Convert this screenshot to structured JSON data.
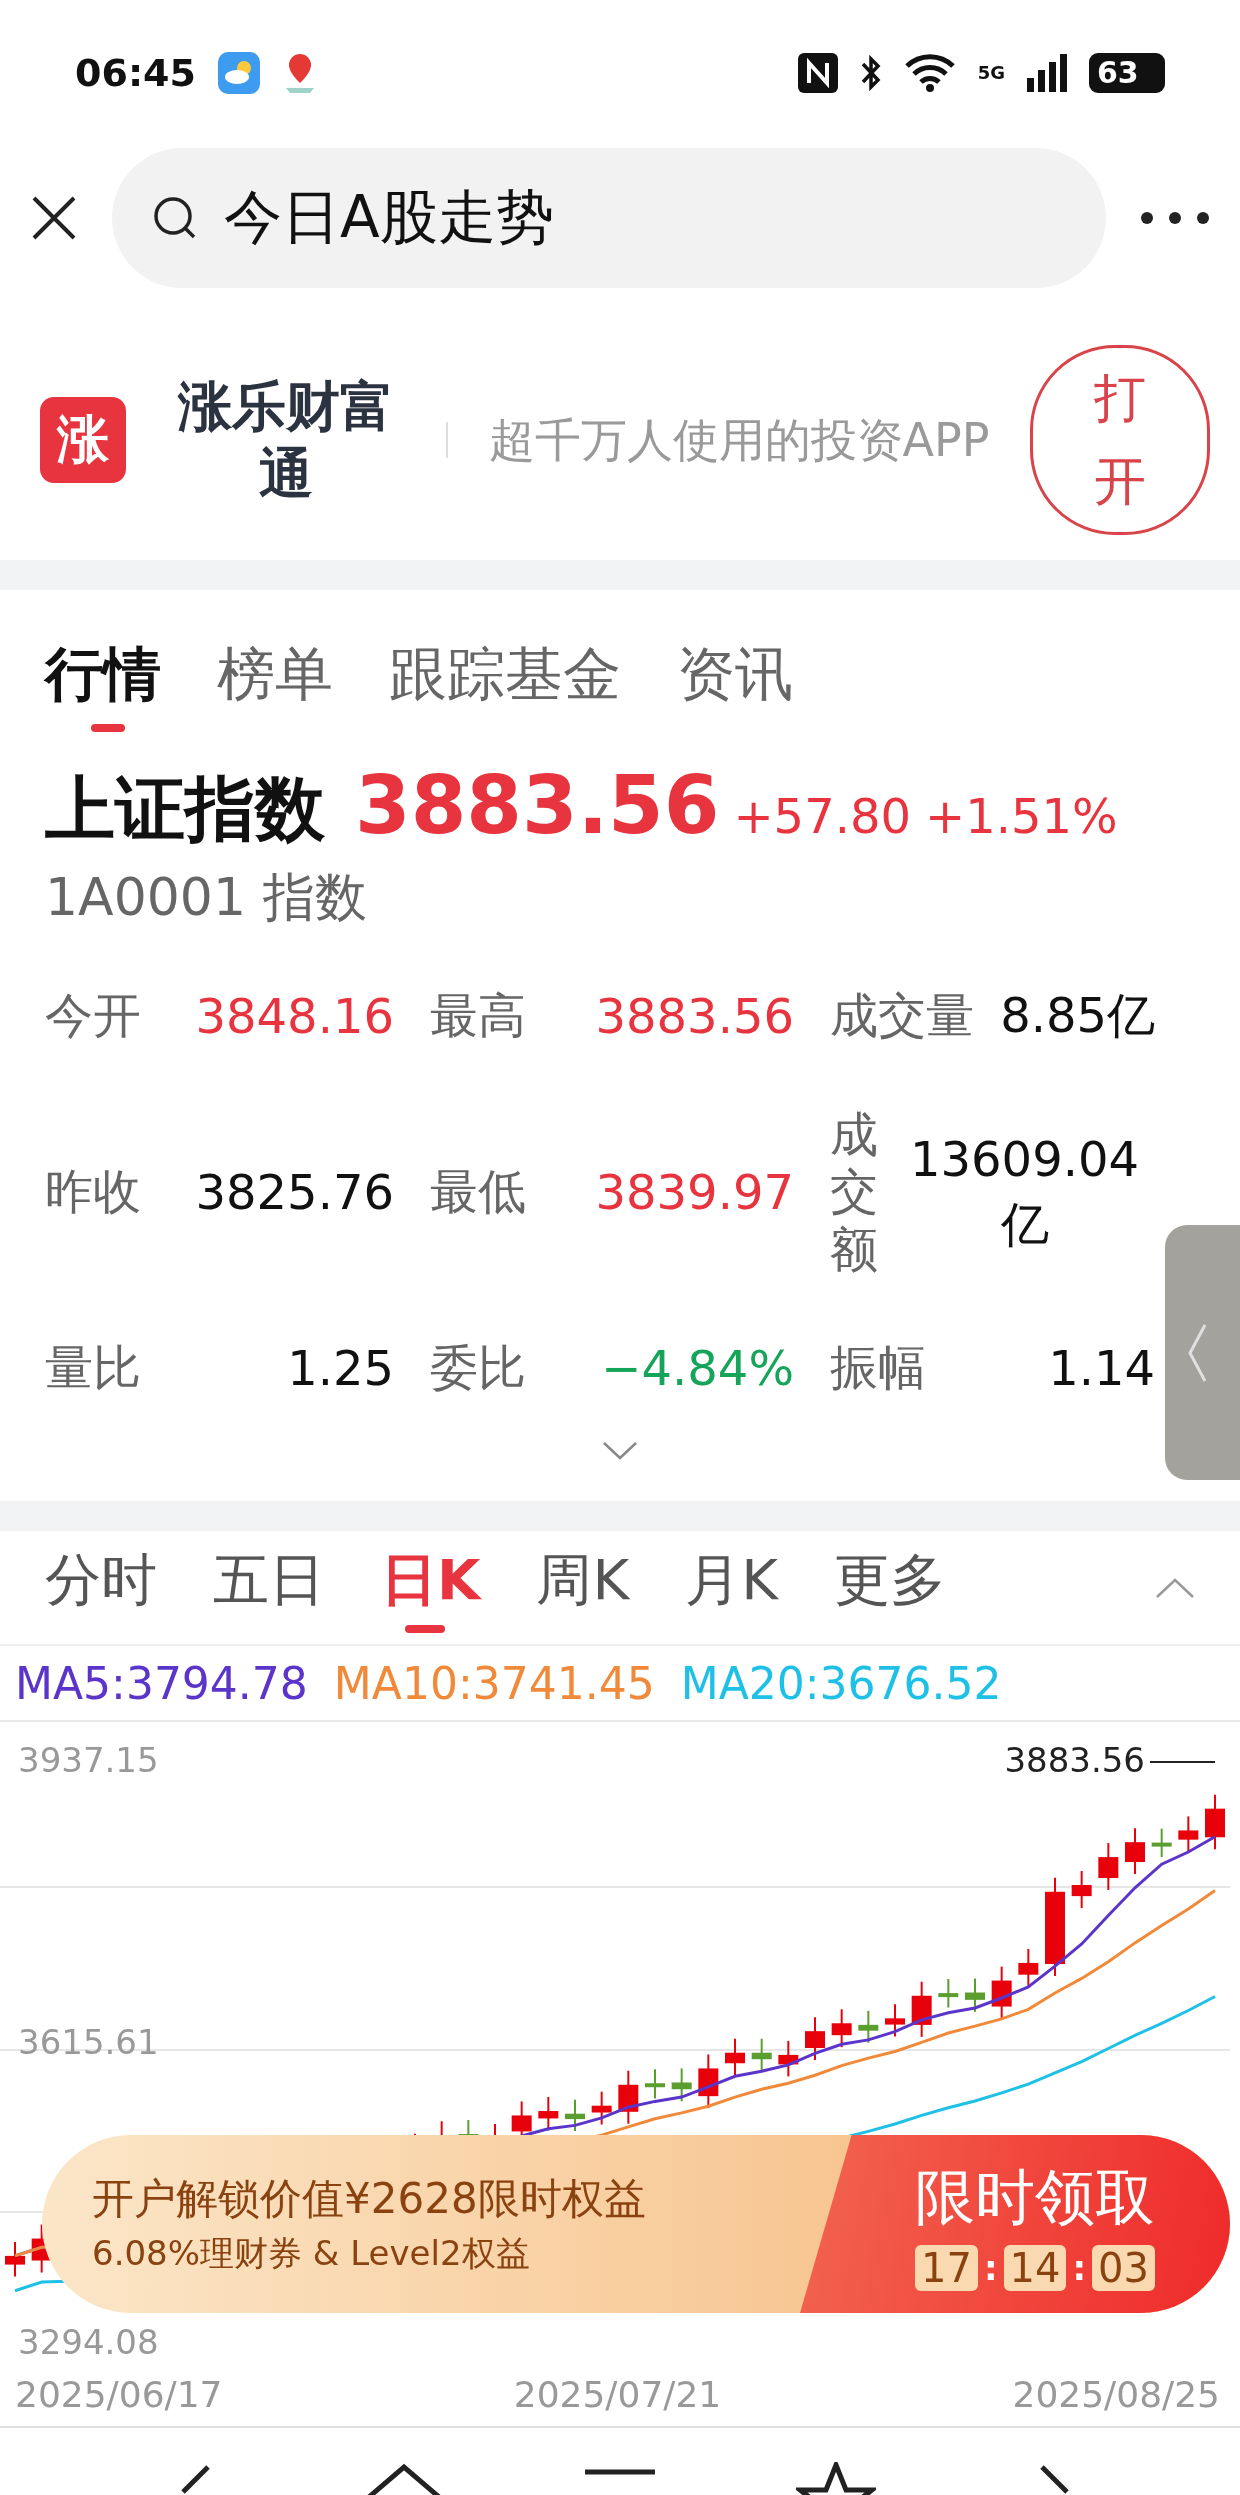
{
  "status_bar": {
    "time": "06:45",
    "network": "5G",
    "battery": "63"
  },
  "search": {
    "value": "今日A股走势"
  },
  "app_banner": {
    "logo": "涨",
    "name": "涨乐财富通",
    "slogan": "超千万人使用的投资APP",
    "button": "打开"
  },
  "tabs": [
    {
      "label": "行情",
      "selected": true
    },
    {
      "label": "榜单",
      "selected": false
    },
    {
      "label": "跟踪基金",
      "selected": false
    },
    {
      "label": "资讯",
      "selected": false
    }
  ],
  "quote": {
    "name": "上证指数",
    "price": "3883.56",
    "change": "+57.80",
    "change_pct": "+1.51%",
    "code": "1A0001",
    "type": "指数"
  },
  "stat_rows": [
    {
      "items": [
        {
          "label": "今开",
          "value": "3848.16",
          "color": "#e8343f"
        },
        {
          "label": "最高",
          "value": "3883.56",
          "color": "#e8343f"
        },
        {
          "label": "成交量",
          "value": "8.85亿",
          "color": "#111111"
        }
      ]
    },
    {
      "items": [
        {
          "label": "昨收",
          "value": "3825.76",
          "color": "#111111"
        },
        {
          "label": "最低",
          "value": "3839.97",
          "color": "#e8343f"
        },
        {
          "label": "成交额",
          "value": "13609.04亿",
          "color": "#111111",
          "kind": "vertical"
        }
      ]
    },
    {
      "items": [
        {
          "label": "量比",
          "value": "1.25",
          "color": "#111111"
        },
        {
          "label": "委比",
          "value": "−4.84%",
          "color": "#16a35a"
        },
        {
          "label": "振幅",
          "value": "1.14",
          "color": "#111111"
        }
      ]
    }
  ],
  "periods": [
    {
      "label": "分时",
      "selected": false
    },
    {
      "label": "五日",
      "selected": false
    },
    {
      "label": "日K",
      "selected": true
    },
    {
      "label": "周K",
      "selected": false
    },
    {
      "label": "月K",
      "selected": false
    },
    {
      "label": "更多",
      "selected": false
    }
  ],
  "moving_averages": [
    {
      "label": "MA5:3794.78",
      "color": "#5b35c9"
    },
    {
      "label": "MA10:3741.45",
      "color": "#f08a3a"
    },
    {
      "label": "MA20:3676.52",
      "color": "#1ec0e6"
    }
  ],
  "chart": {
    "y_labels": [
      "3937.15",
      "3615.61",
      "3294.08"
    ],
    "last_price": "3883.56",
    "dates": [
      "2025/06/17",
      "2025/07/21",
      "2025/08/25"
    ]
  },
  "promo": {
    "title": "开户解锁价值¥2628限时权益",
    "subtitle": "6.08%理财券 & Level2权益",
    "action": "限时领取",
    "countdown": [
      "17",
      "14",
      "03"
    ],
    "separator": ":"
  }
}
